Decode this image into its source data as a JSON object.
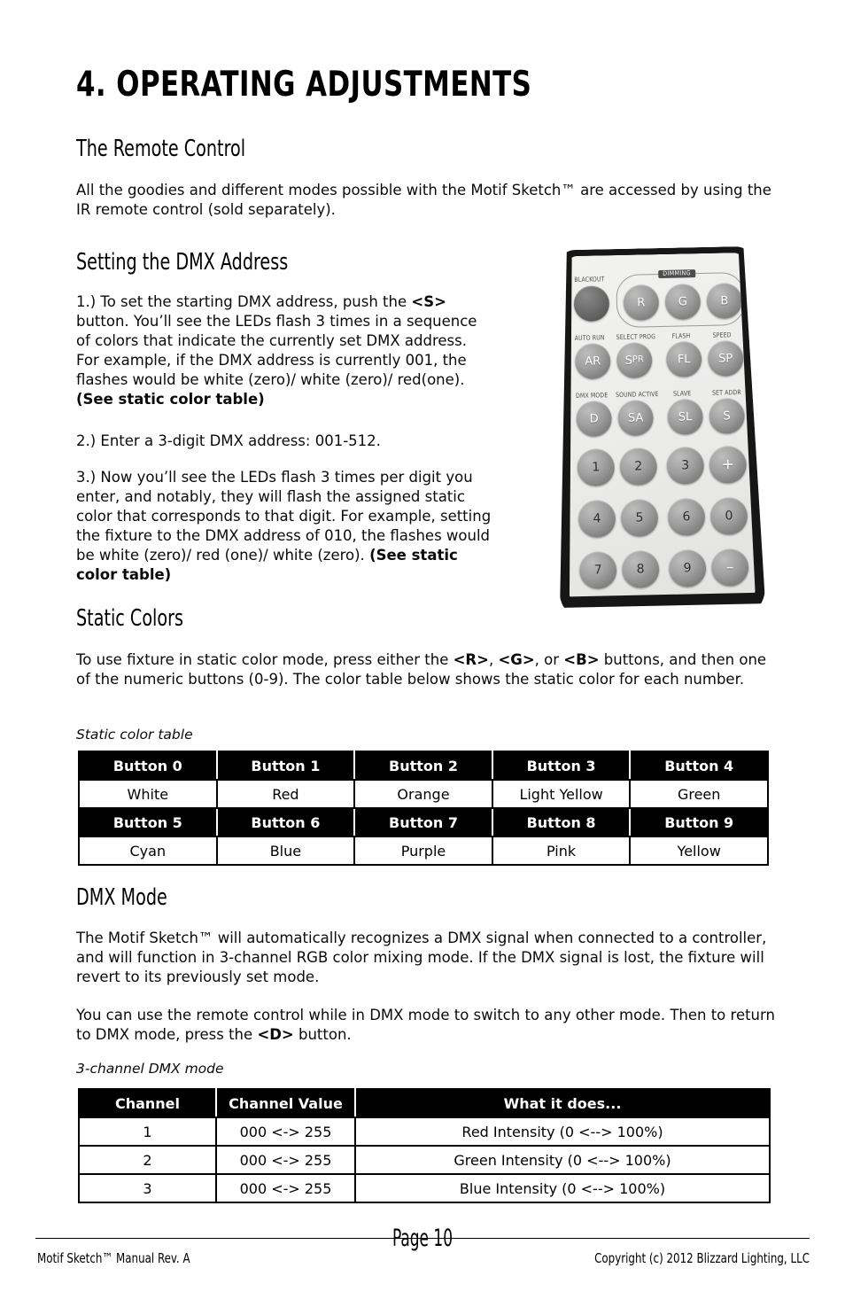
{
  "document": {
    "chapter_title": "4. OPERATING ADJUSTMENTS"
  },
  "sections": {
    "remote_control": {
      "heading": "The Remote Control",
      "paragraph": "All the goodies and different modes possible with the Motif Sketch™ are accessed by using the IR remote control (sold separately)."
    },
    "dmx_address": {
      "heading": "Setting the DMX Address",
      "step1_a": "1.) To set the starting DMX address, push the ",
      "step1_b": "<S>",
      "step1_c": " button. You’ll see the LEDs flash 3 times in a sequence of colors that indicate the currently set DMX address. For example, if the DMX address is currently 001, the flashes would be white (zero)/ white (zero)/ red(one). ",
      "step1_d": "(See static color table)",
      "step2": "2.) Enter a 3-digit DMX address: 001-512.",
      "step3_a": "3.) Now you’ll see the LEDs flash 3 times per digit you enter, and notably, they will flash the assigned static color that corresponds to that digit. For example, setting the fixture to the DMX address of 010, the flashes would be white (zero)/ red (one)/ white (zero). ",
      "step3_b": "(See static color table)"
    },
    "static_colors": {
      "heading": "Static Colors",
      "para_a": "To use fixture in static color mode, press either the ",
      "para_r": "<R>",
      "para_sep1": ", ",
      "para_g": "<G>",
      "para_sep2": ", or ",
      "para_b": "<B>",
      "para_c": " buttons, and then one of the numeric buttons (0-9). The color table below shows the static color for each number.",
      "table_caption": "Static color table"
    },
    "dmx_mode": {
      "heading": "DMX Mode",
      "paragraph1": "The Motif Sketch™ will automatically recognizes a DMX signal when connected to a controller, and will function in 3-channel RGB color mixing mode. If the DMX signal is lost, the fixture will revert to its previously set mode.",
      "paragraph2_a": "You can use the remote control while in DMX mode to switch to any other mode. Then to return to DMX mode, press the ",
      "paragraph2_b": "<D>",
      "paragraph2_c": " button.",
      "table_caption": "3-channel DMX mode"
    }
  },
  "static_color_table": {
    "header_row_1": [
      "Button 0",
      "Button 1",
      "Button 2",
      "Button 3",
      "Button 4"
    ],
    "value_row_1": [
      "White",
      "Red",
      "Orange",
      "Light Yellow",
      "Green"
    ],
    "header_row_2": [
      "Button 5",
      "Button 6",
      "Button 7",
      "Button 8",
      "Button 9"
    ],
    "value_row_2": [
      "Cyan",
      "Blue",
      "Purple",
      "Pink",
      "Yellow"
    ]
  },
  "dmx_mode_table": {
    "headers": [
      "Channel",
      "Channel Value",
      "What it does..."
    ],
    "rows": [
      {
        "channel": "1",
        "value": "000 <-> 255",
        "does": "Red Intensity (0 <--> 100%)"
      },
      {
        "channel": "2",
        "value": "000 <-> 255",
        "does": "Green Intensity (0 <--> 100%)"
      },
      {
        "channel": "3",
        "value": "000 <-> 255",
        "does": "Blue Intensity (0 <--> 100%)"
      }
    ]
  },
  "remote": {
    "dimming_label": "DIMMING",
    "labels": {
      "blackout": "BLACKOUT",
      "auto_run": "AUTO RUN",
      "select_prog": "SELECT PROG",
      "flash": "FLASH",
      "speed": "SPEED",
      "dmx_mode": "DMX MODE",
      "sound_active": "SOUND ACTIVE",
      "slave": "SLAVE",
      "set_addr": "SET ADDR"
    },
    "buttons": {
      "blackout": "",
      "r": "R",
      "g": "G",
      "b": "B",
      "ar": "AR",
      "spr_main": "S",
      "spr_sub": "PR",
      "fl": "FL",
      "sp": "SP",
      "d": "D",
      "sa": "SA",
      "sl": "SL",
      "s": "S",
      "n1": "1",
      "n2": "2",
      "n3": "3",
      "plus": "+",
      "n4": "4",
      "n5": "5",
      "n6": "6",
      "n0": "0",
      "n7": "7",
      "n8": "8",
      "n9": "9",
      "minus": "–"
    }
  },
  "footer": {
    "left": "Motif Sketch™ Manual Rev. A",
    "page": "Page 10",
    "right": "Copyright (c) 2012 Blizzard Lighting, LLC"
  }
}
